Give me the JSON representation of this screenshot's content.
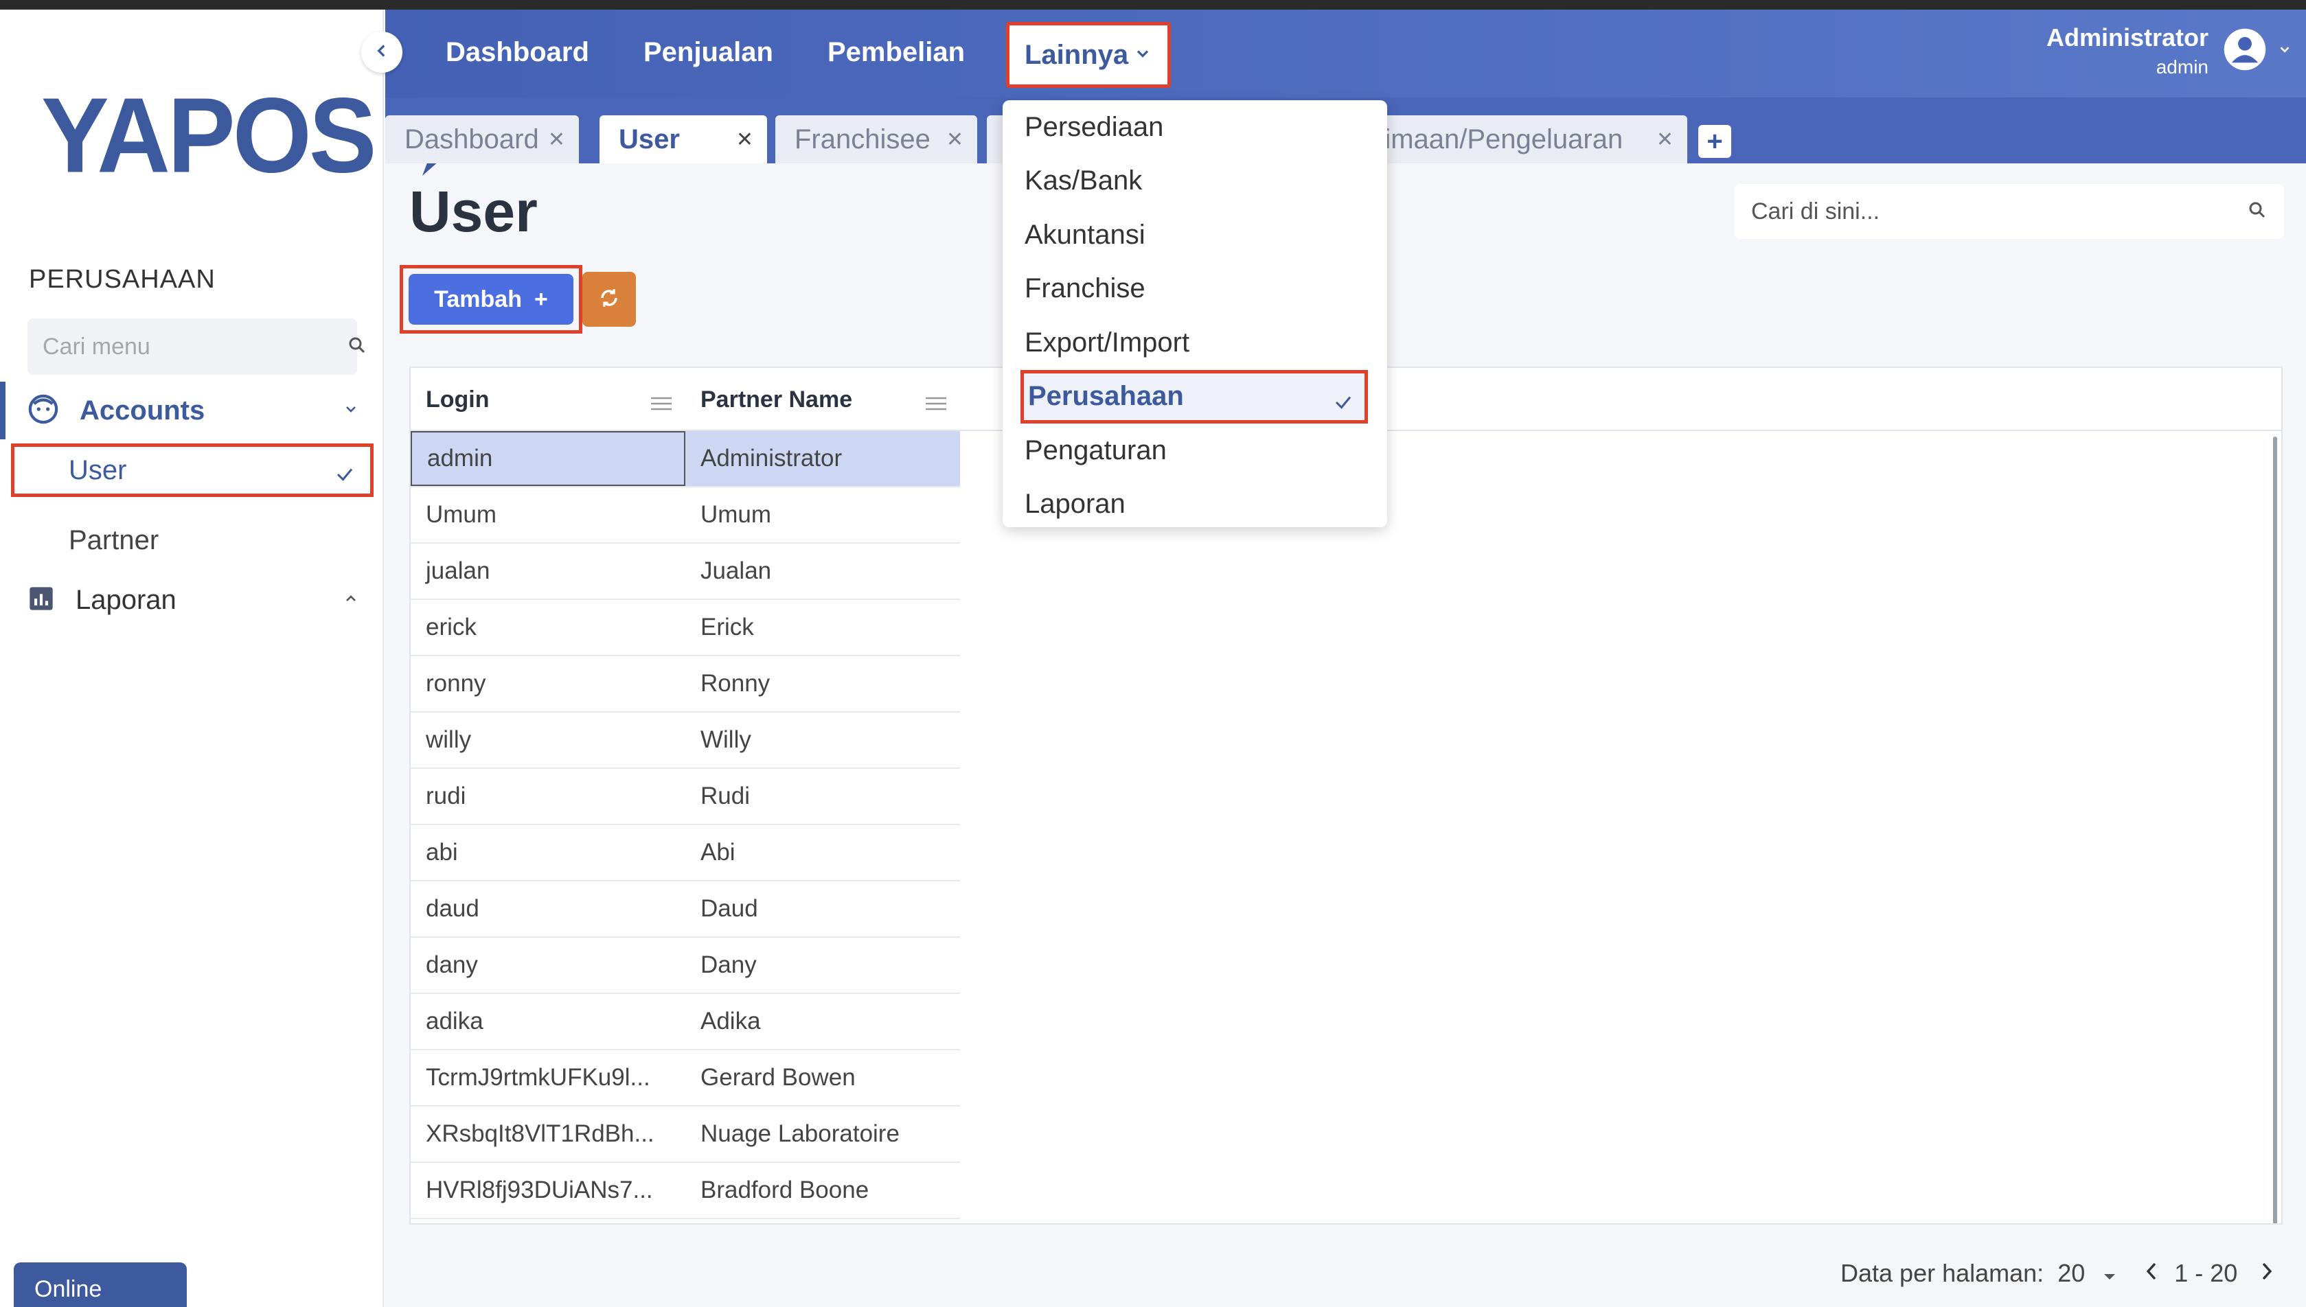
{
  "brand": {
    "logo_text": "YAPOS",
    "accent": "#3d5a9e",
    "header_color": "#4461b5",
    "highlight": "#e0402a"
  },
  "sidebar": {
    "company_title": "PERUSAHAAN",
    "search_placeholder": "Cari menu",
    "groups": [
      {
        "label": "Accounts",
        "icon": "face-icon",
        "expanded": true,
        "items": [
          {
            "label": "User",
            "selected": true
          },
          {
            "label": "Partner",
            "selected": false
          }
        ]
      },
      {
        "label": "Laporan",
        "icon": "bar-chart-icon",
        "expanded": false
      }
    ],
    "status": "Online"
  },
  "header": {
    "nav": [
      "Dashboard",
      "Penjualan",
      "Pembelian"
    ],
    "more_label": "Lainnya",
    "user_name": "Administrator",
    "user_role": "admin"
  },
  "tabs": [
    {
      "label": "Dashboard",
      "active": false
    },
    {
      "label": "User",
      "active": true
    },
    {
      "label": "Franchisee",
      "active": false
    },
    {
      "label": "rimaan/Pengeluaran",
      "active": false
    }
  ],
  "dropdown": {
    "items": [
      "Persediaan",
      "Kas/Bank",
      "Akuntansi",
      "Franchise",
      "Export/Import",
      "Perusahaan",
      "Pengaturan",
      "Laporan"
    ],
    "selected": "Perusahaan"
  },
  "main": {
    "title": "User",
    "search_placeholder": "Cari di sini...",
    "add_label": "Tambah",
    "table": {
      "columns": [
        "Login",
        "Partner Name"
      ],
      "rows": [
        [
          "admin",
          "Administrator"
        ],
        [
          "Umum",
          "Umum"
        ],
        [
          "jualan",
          "Jualan"
        ],
        [
          "erick",
          "Erick"
        ],
        [
          "ronny",
          "Ronny"
        ],
        [
          "willy",
          "Willy"
        ],
        [
          "rudi",
          "Rudi"
        ],
        [
          "abi",
          "Abi"
        ],
        [
          "daud",
          "Daud"
        ],
        [
          "dany",
          "Dany"
        ],
        [
          "adika",
          "Adika"
        ],
        [
          "TcrmJ9rtmkUFKu9l...",
          "Gerard Bowen"
        ],
        [
          "XRsbqIt8VlT1RdBh...",
          "Nuage Laboratoire"
        ],
        [
          "HVRl8fj93DUiANs7...",
          "Bradford Boone"
        ]
      ]
    }
  },
  "footer": {
    "per_page_label": "Data per halaman:",
    "per_page": "20",
    "range": "1 - 20"
  }
}
